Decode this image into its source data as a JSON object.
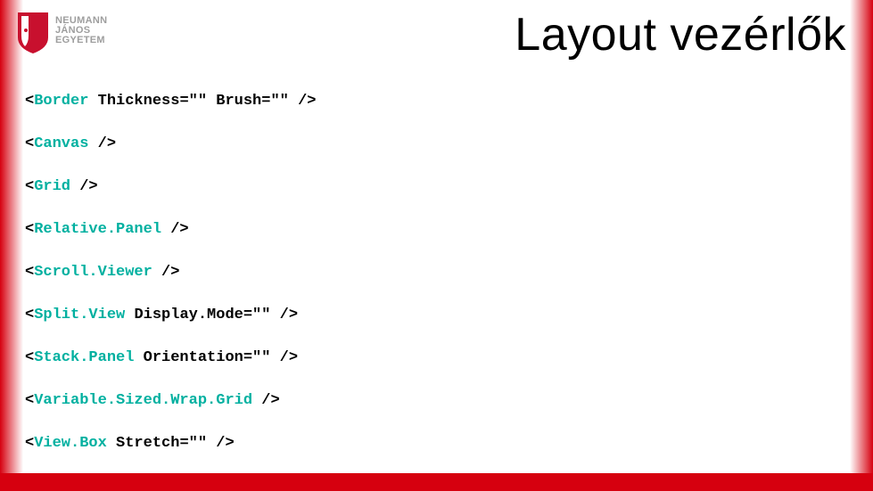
{
  "header": {
    "logo_text_1": "NEUMANN",
    "logo_text_2": "JÁNOS",
    "logo_text_3": "EGYETEM",
    "title": "Layout vezérlők"
  },
  "code_lines": [
    {
      "tag": "Border",
      "attrs": [
        {
          "n": "Thickness",
          "v": ""
        },
        {
          "n": "Brush",
          "v": ""
        }
      ]
    },
    {
      "tag": "Canvas",
      "attrs": []
    },
    {
      "tag": "Grid",
      "attrs": []
    },
    {
      "tag": "Relative.Panel",
      "attrs": []
    },
    {
      "tag": "Scroll.Viewer",
      "attrs": []
    },
    {
      "tag": "Split.View",
      "attrs": [
        {
          "n": "Display.Mode",
          "v": ""
        }
      ]
    },
    {
      "tag": "Stack.Panel",
      "attrs": [
        {
          "n": "Orientation",
          "v": ""
        }
      ]
    },
    {
      "tag": "Variable.Sized.Wrap.Grid",
      "attrs": []
    },
    {
      "tag": "View.Box",
      "attrs": [
        {
          "n": "Stretch",
          "v": ""
        }
      ]
    }
  ]
}
